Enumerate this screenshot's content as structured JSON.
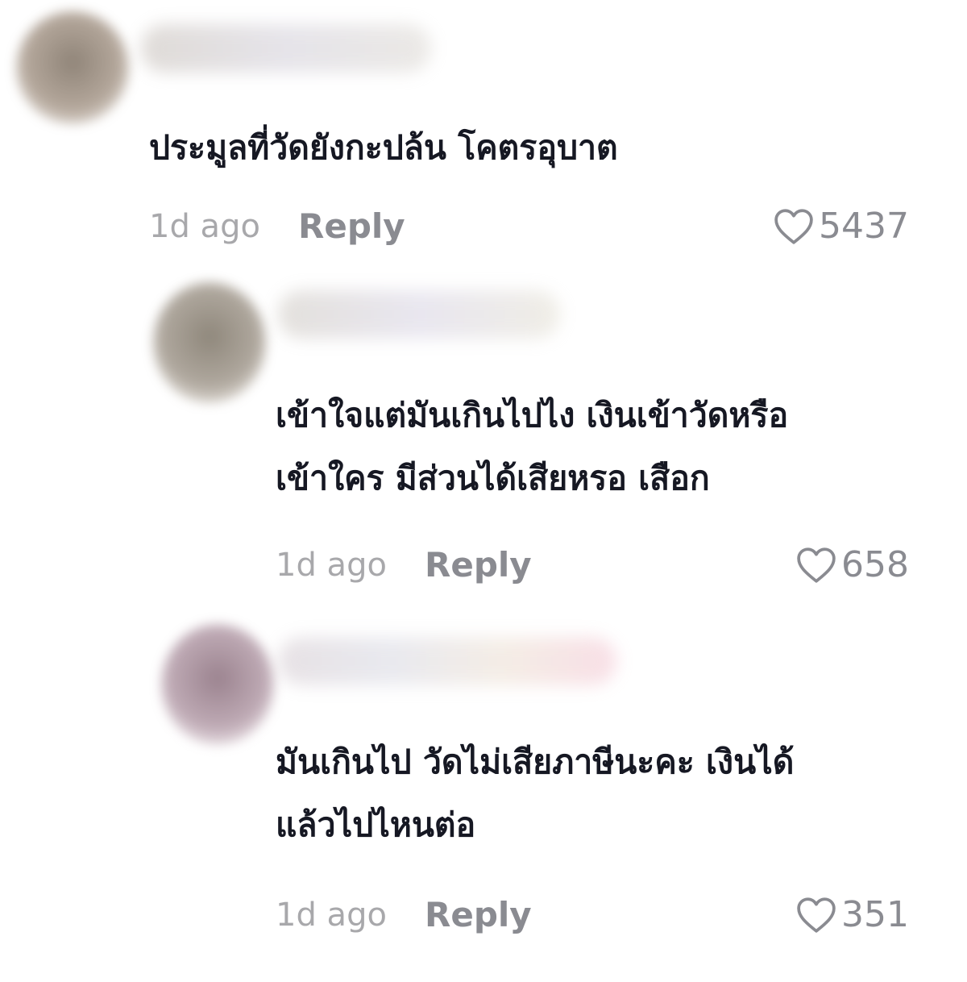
{
  "comments": [
    {
      "text_lines": [
        "ประมูลที่วัดยังกะปล้น โคตรอุบาต"
      ],
      "time": "1d ago",
      "reply_label": "Reply",
      "likes": "5437",
      "icon": "heart-outline-icon"
    },
    {
      "text_lines": [
        "เข้าใจแต่มันเกินไปไง เงินเข้าวัดหรือ",
        "เข้าใคร มีส่วนได้เสียหรอ เสือก"
      ],
      "time": "1d ago",
      "reply_label": "Reply",
      "likes": "658",
      "icon": "heart-outline-icon"
    },
    {
      "text_lines": [
        "มันเกินไป วัดไม่เสียภาษีนะคะ เงินได้",
        "แล้วไปไหนต่อ"
      ],
      "time": "1d ago",
      "reply_label": "Reply",
      "likes": "351",
      "icon": "heart-outline-icon"
    }
  ],
  "colors": {
    "text": "#161823",
    "meta": "#a8a8ab",
    "action": "#8a8b91",
    "background": "#ffffff"
  }
}
